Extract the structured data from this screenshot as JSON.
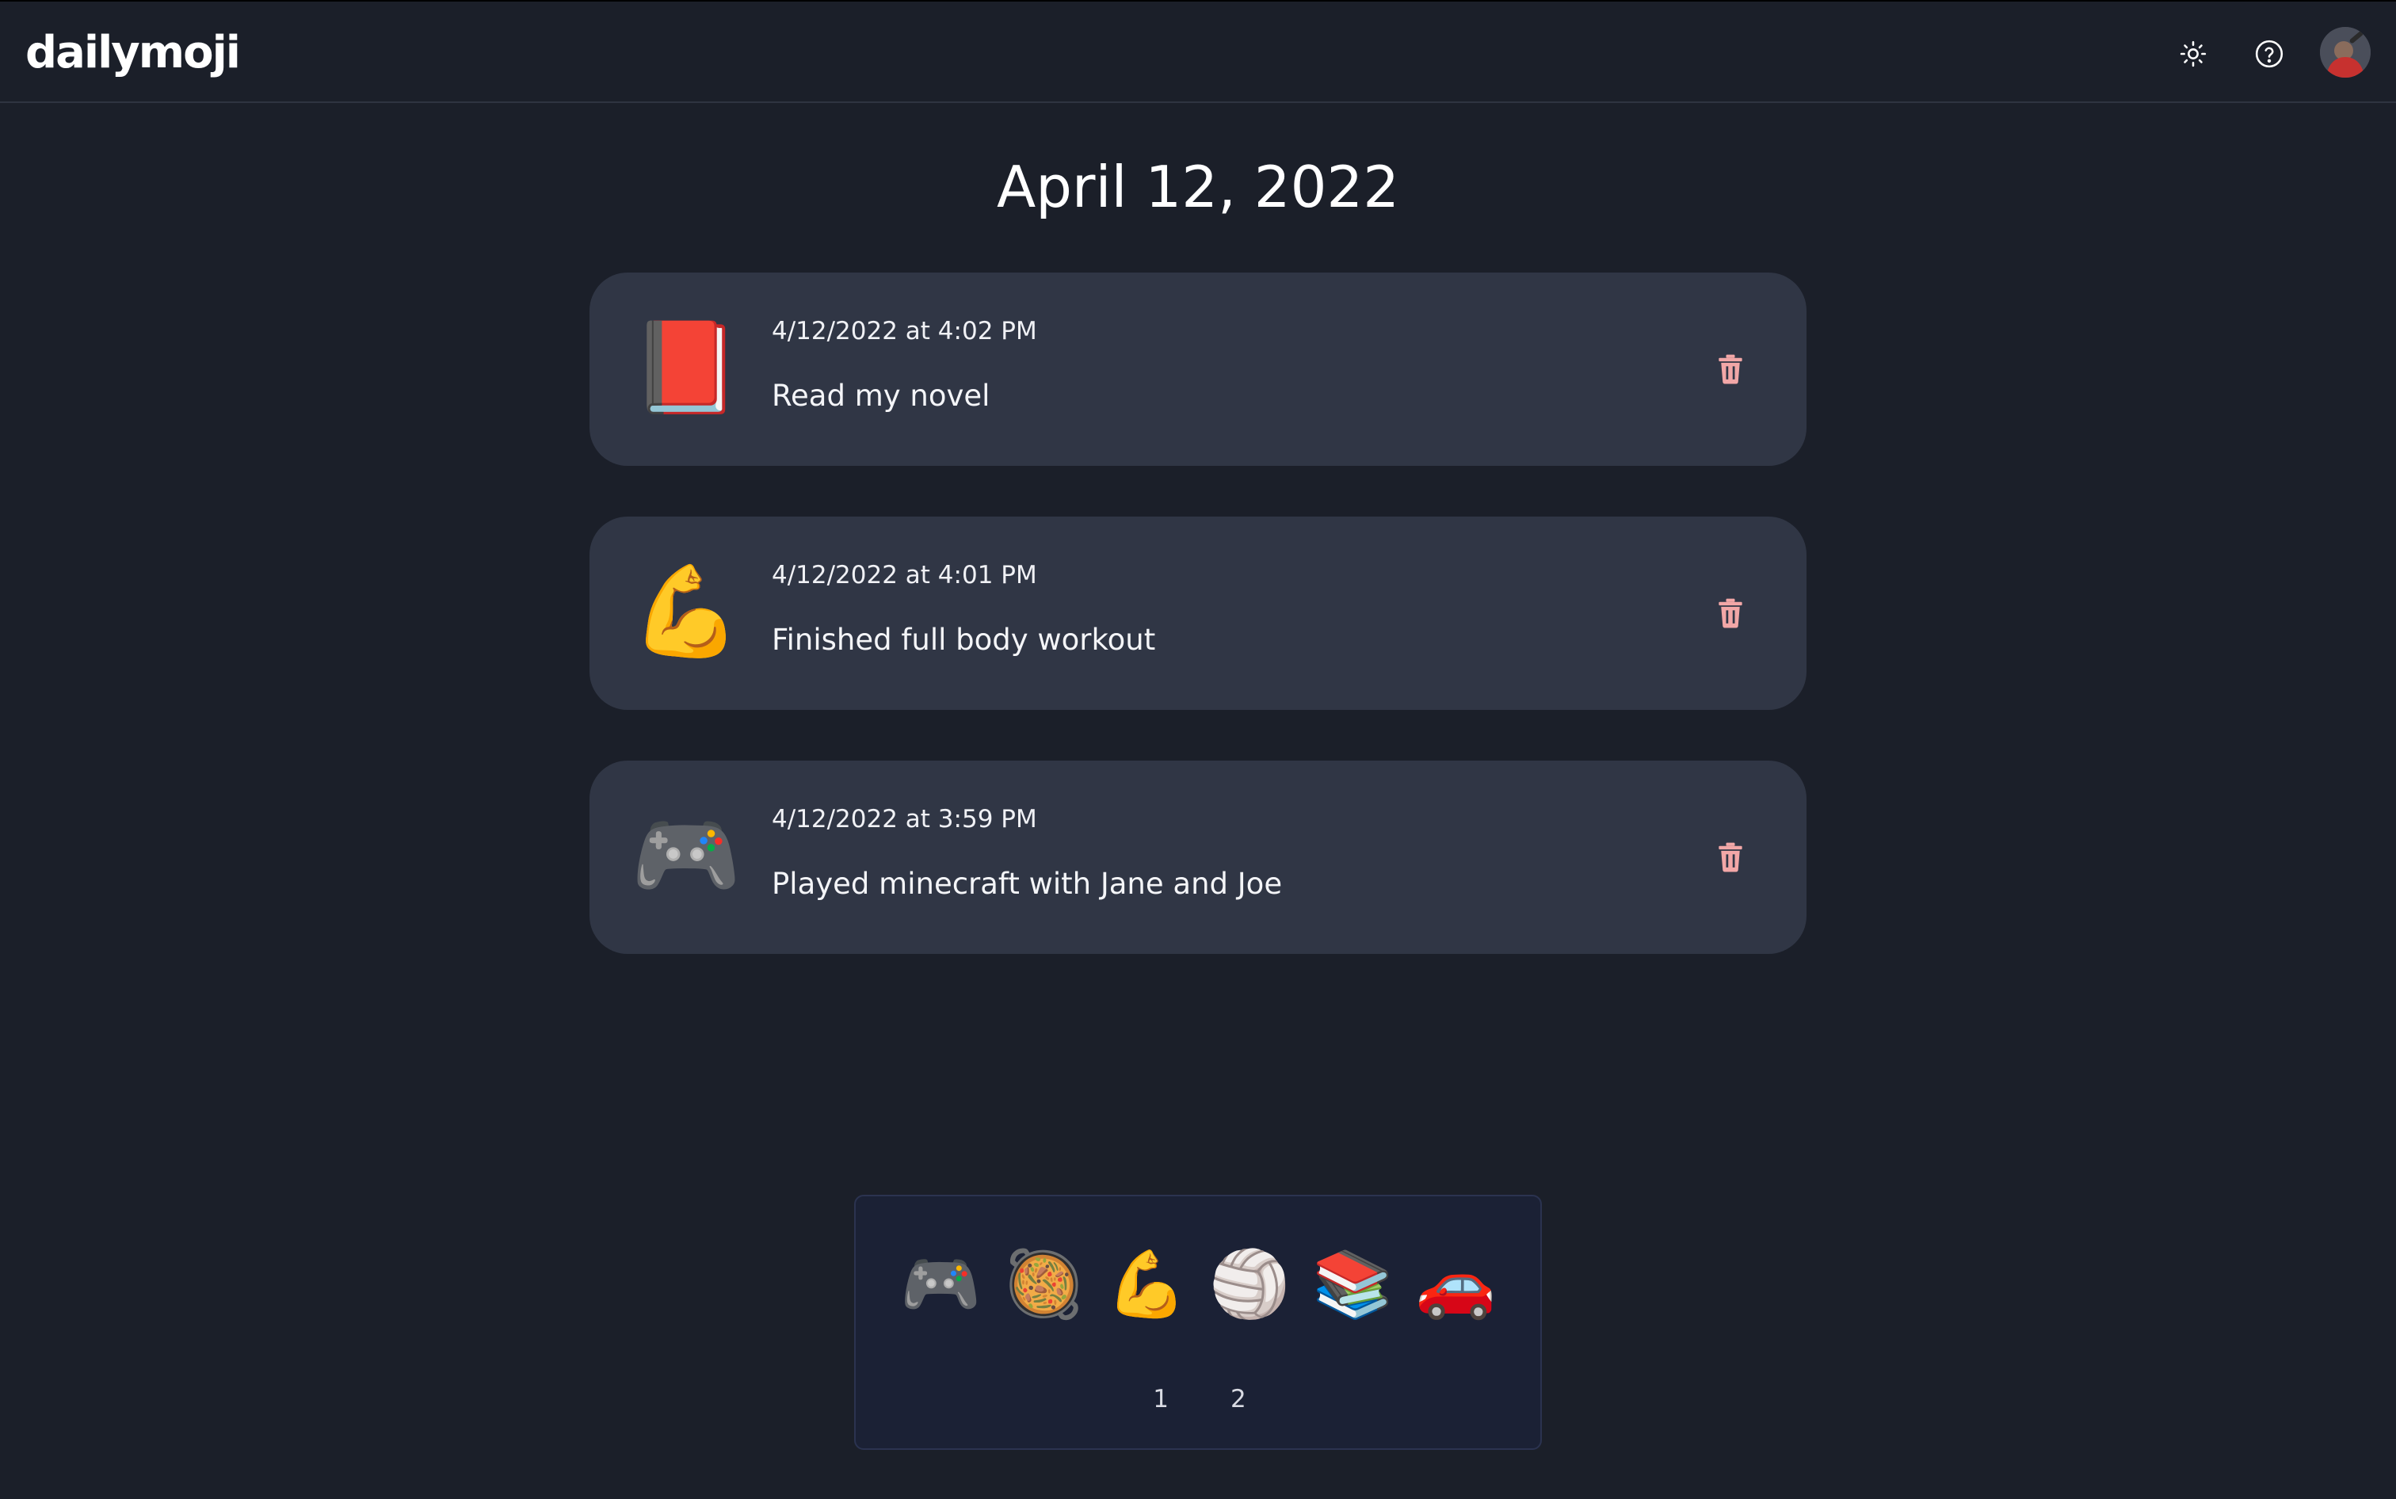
{
  "app": {
    "logo": "dailymoji",
    "header_icons": [
      "sun-icon",
      "help-icon",
      "avatar"
    ]
  },
  "page": {
    "title": "April 12, 2022"
  },
  "entries": [
    {
      "emoji": "📕",
      "emoji_name": "red-book",
      "time": "4/12/2022 at 4:02 PM",
      "text": "Read my novel"
    },
    {
      "emoji": "💪",
      "emoji_name": "flexed-biceps",
      "time": "4/12/2022 at 4:01 PM",
      "text": "Finished full body workout"
    },
    {
      "emoji": "🎮",
      "emoji_name": "video-game-controller",
      "time": "4/12/2022 at 3:59 PM",
      "text": "Played minecraft with Jane and Joe"
    }
  ],
  "picker": {
    "emojis": [
      {
        "char": "🎮",
        "name": "video-game-controller"
      },
      {
        "char": "🥘",
        "name": "shallow-pan-of-food"
      },
      {
        "char": "💪",
        "name": "flexed-biceps"
      },
      {
        "char": "🏐",
        "name": "volleyball"
      },
      {
        "char": "📚",
        "name": "books"
      },
      {
        "char": "🚗",
        "name": "car"
      }
    ],
    "pages": [
      "1",
      "2"
    ]
  },
  "colors": {
    "background": "#1b1f29",
    "card": "#303645",
    "trash": "#f2a7a7",
    "picker_bg": "#1b2135"
  }
}
